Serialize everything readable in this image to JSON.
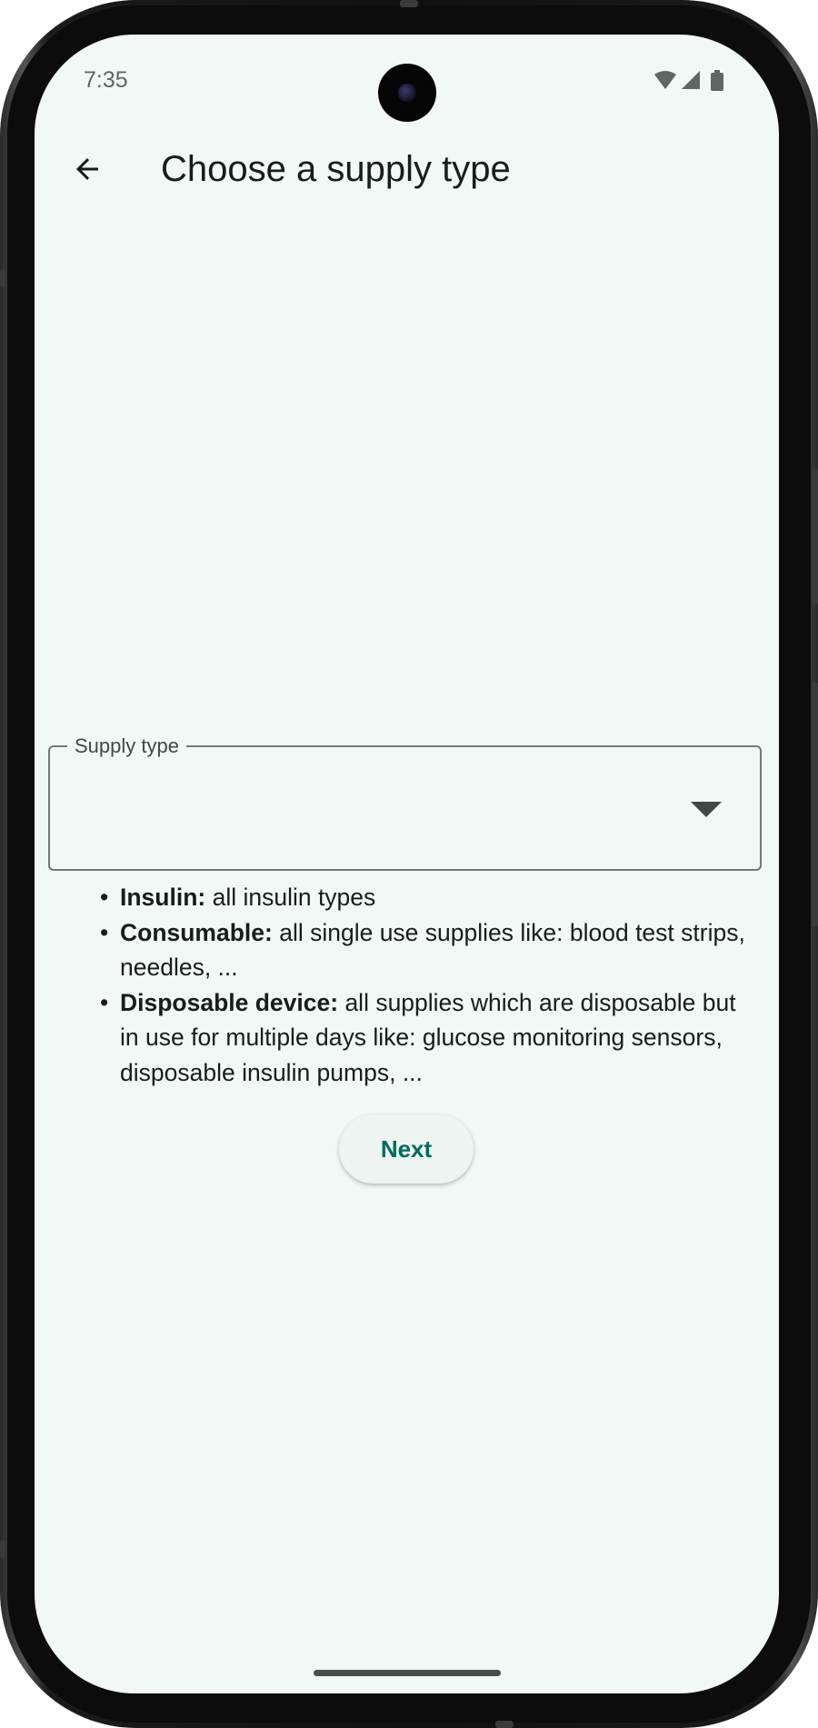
{
  "status_bar": {
    "time": "7:35",
    "icons": [
      "wifi-icon",
      "signal-icon",
      "battery-icon"
    ]
  },
  "app_bar": {
    "back_icon": "arrow-back-icon",
    "title": "Choose a supply type"
  },
  "supply_field": {
    "label": "Supply type",
    "value": "",
    "arrow_icon": "dropdown-arrow-icon"
  },
  "descriptions": [
    {
      "bullet": "•",
      "term": "Insulin:",
      "text": " all insulin types"
    },
    {
      "bullet": "•",
      "term": "Consumable:",
      "text": " all single use supplies like: blood test strips, needles, ..."
    },
    {
      "bullet": "•",
      "term": "Disposable device:",
      "text": " all supplies which are disposable but in use for multiple days like: glucose monitoring sensors, disposable insulin pumps, ..."
    }
  ],
  "next_button": {
    "label": "Next"
  },
  "colors": {
    "background": "#f1f8f5",
    "accent": "#006b5e",
    "text": "#171d1b",
    "outline": "#6f7975"
  }
}
